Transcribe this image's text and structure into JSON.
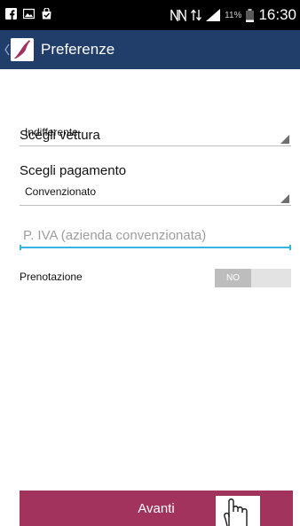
{
  "statusbar": {
    "left_icons": [
      "facebook-icon",
      "image-icon",
      "bag-icon"
    ],
    "right_icons": [
      "nfc-icon",
      "data-arrows-icon",
      "signal-icon",
      "battery-icon"
    ],
    "battery": "11%",
    "time": "16:30"
  },
  "actionbar": {
    "title": "Preferenze",
    "color": "#213e6b"
  },
  "form": {
    "vehicle": {
      "label": "Scegli vettura",
      "value": "Indifferente"
    },
    "payment": {
      "label": "Scegli pagamento",
      "value": "Convenzionato"
    },
    "vat": {
      "placeholder": "P. IVA (azienda convenzionata)",
      "value": ""
    },
    "booking": {
      "label": "Prenotazione",
      "toggle_text": "NO",
      "state": false
    }
  },
  "footer": {
    "button_label": "Avanti",
    "button_color": "#a1335d"
  },
  "colors": {
    "accent": "#33b5e5",
    "toggle_off": "#bdbdbd"
  }
}
